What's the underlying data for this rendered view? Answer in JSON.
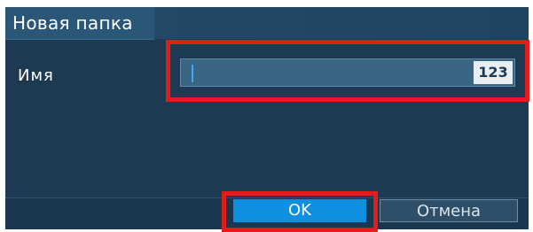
{
  "dialog": {
    "title": "Новая папка"
  },
  "form": {
    "name_label": "Имя",
    "name_value": "",
    "char_count": "123"
  },
  "buttons": {
    "ok_label": "OK",
    "cancel_label": "Отмена"
  },
  "colors": {
    "dialog_bg": "#1d3a52",
    "accent": "#0f8fe0",
    "highlight": "#e21b1b"
  }
}
